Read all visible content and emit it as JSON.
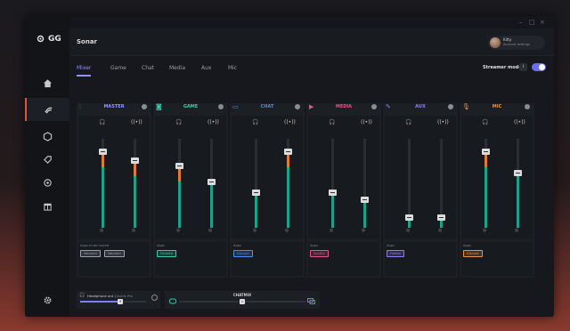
{
  "window": {
    "controls": [
      "–",
      "□",
      "×"
    ]
  },
  "brand": {
    "name": "GG"
  },
  "header": {
    "title": "Sonar",
    "user": {
      "name": "Kitty",
      "subtitle": "Account settings"
    }
  },
  "tabs": [
    {
      "label": "Mixer",
      "active": true
    },
    {
      "label": "Game"
    },
    {
      "label": "Chat"
    },
    {
      "label": "Media"
    },
    {
      "label": "Aux"
    },
    {
      "label": "Mic"
    }
  ],
  "streamer_mode": {
    "label": "Streamer mode",
    "info": "i",
    "enabled": true
  },
  "channels": [
    {
      "name": "MASTER",
      "color": "#8f92ff",
      "icon": "sliders-icon",
      "sliders": [
        {
          "level": 0.86,
          "fill_top": "#e07b3a",
          "fill": "#1fa08a"
        },
        {
          "level": 0.76,
          "fill_top": "#e07b3a",
          "fill": "#1fa08a"
        }
      ],
      "apps_label": "Apps to be routed",
      "apps": [
        {
          "name": "Valorant",
          "color": "#9aa0a8"
        },
        {
          "name": "Valorant",
          "color": "#9aa0a8"
        }
      ]
    },
    {
      "name": "GAME",
      "color": "#39c9a8",
      "icon": "gamepad-icon",
      "sliders": [
        {
          "level": 0.7,
          "fill_top": "#e07b3a",
          "fill": "#1fa08a"
        },
        {
          "level": 0.52,
          "fill": "#1fa08a"
        }
      ],
      "apps_label": "Apps",
      "apps": [
        {
          "name": "Fortnite",
          "color": "#39c9a8"
        }
      ]
    },
    {
      "name": "CHAT",
      "color": "#4a8ef0",
      "icon": "chat-icon",
      "sliders": [
        {
          "level": 0.4,
          "fill": "#1fa08a"
        },
        {
          "level": 0.86,
          "fill_top": "#e07b3a",
          "fill": "#1fa08a"
        }
      ],
      "apps_label": "Apps",
      "apps": [
        {
          "name": "Discord",
          "color": "#4a8ef0"
        }
      ]
    },
    {
      "name": "MEDIA",
      "color": "#e0558a",
      "icon": "media-icon",
      "sliders": [
        {
          "level": 0.4,
          "fill": "#1fa08a"
        },
        {
          "level": 0.32,
          "fill": "#1fa08a"
        }
      ],
      "apps_label": "Apps",
      "apps": [
        {
          "name": "Spotify",
          "color": "#e0558a"
        }
      ]
    },
    {
      "name": "AUX",
      "color": "#8f7ff0",
      "icon": "pen-icon",
      "sliders": [
        {
          "level": 0.12,
          "fill": "#1fa08a"
        },
        {
          "level": 0.12,
          "fill": "#1fa08a"
        }
      ],
      "apps_label": "Apps",
      "apps": [
        {
          "name": "Firefox",
          "color": "#8f7ff0"
        }
      ]
    },
    {
      "name": "MIC",
      "color": "#e8924a",
      "icon": "mic-icon",
      "sliders": [
        {
          "level": 0.86,
          "fill_top": "#e07b3a",
          "fill": "#1fa08a"
        },
        {
          "level": 0.62,
          "fill": "#1fa08a"
        }
      ],
      "apps_label": "Apps",
      "apps": [
        {
          "name": "Discord",
          "color": "#e8924a"
        }
      ]
    }
  ],
  "headphone": {
    "label": "Headphone out",
    "device": "Arctis Pro",
    "value": "3",
    "level": 0.6
  },
  "chatmix": {
    "label": "CHATMIX",
    "value": "1"
  }
}
